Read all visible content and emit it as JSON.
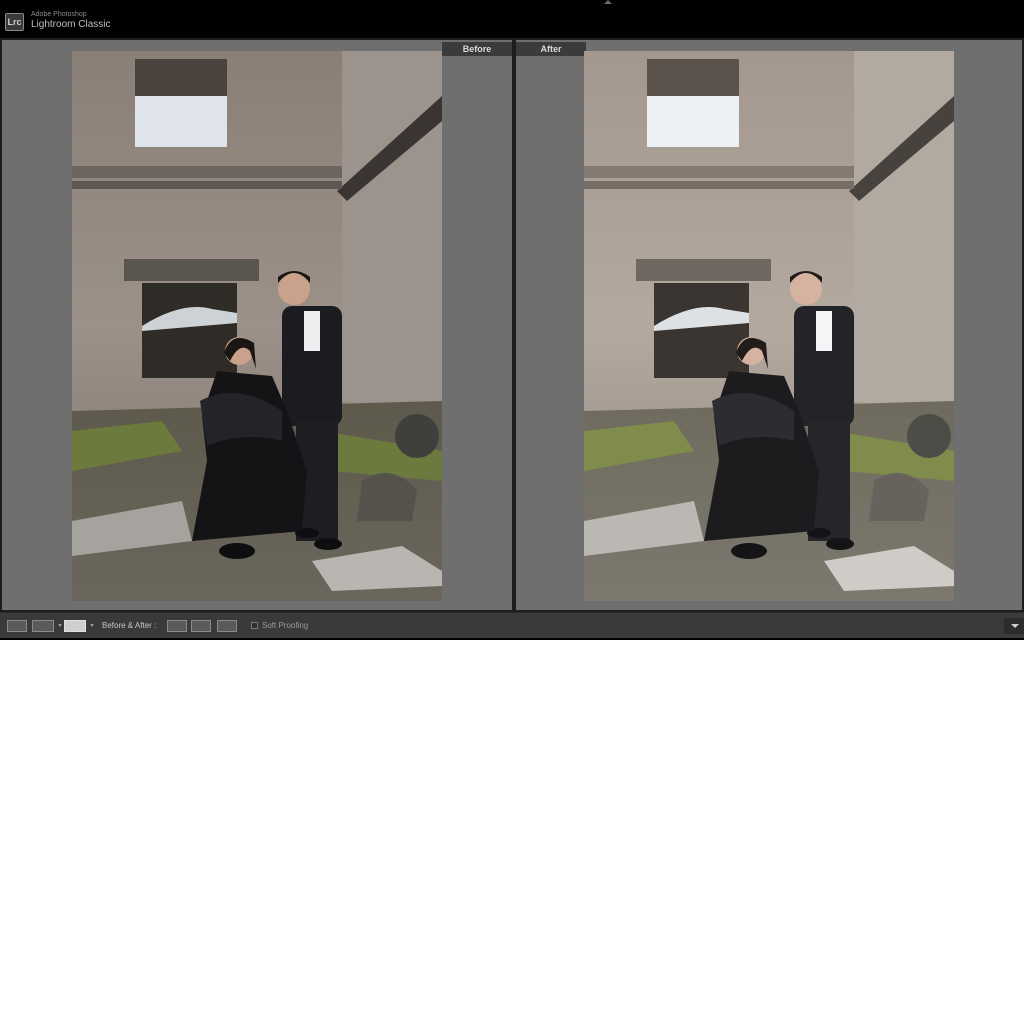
{
  "app": {
    "vendor": "Adobe Photoshop",
    "name": "Lightroom Classic",
    "logo_text": "Lrc"
  },
  "panes": {
    "before_label": "Before",
    "after_label": "After"
  },
  "toolbar": {
    "before_after_label": "Before & After :",
    "soft_proofing_label": "Soft Proofing",
    "soft_proofing_checked": false
  },
  "colors": {
    "workspace_bg": "#6f6f6f",
    "titlebar_bg": "#000000",
    "toolbar_bg": "#3a3a3a"
  }
}
